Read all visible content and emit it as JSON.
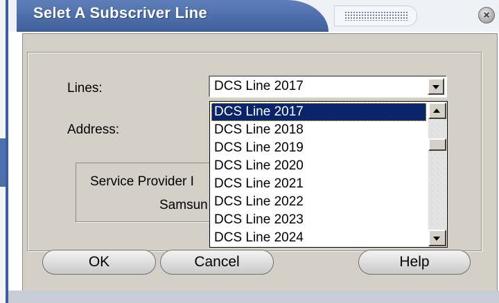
{
  "window": {
    "title": "Selet A Subscriver Line"
  },
  "form": {
    "lines_label": "Lines:",
    "address_label": "Address:",
    "lines_selected": "DCS Line 2017"
  },
  "info_box": {
    "line1": "Service Provider I",
    "line2": "Samsun"
  },
  "dropdown": {
    "items": [
      "DCS Line 2017",
      "DCS Line 2018",
      "DCS Line 2019",
      "DCS Line 2020",
      "DCS Line 2021",
      "DCS Line 2022",
      "DCS Line 2023",
      "DCS Line 2024"
    ],
    "selected_index": 0
  },
  "buttons": {
    "ok": "OK",
    "cancel": "Cancel",
    "help": "Help"
  },
  "colors": {
    "title_bar": "#4d6fae",
    "selection": "#0a246a",
    "dialog_face": "#d4d0c8"
  }
}
